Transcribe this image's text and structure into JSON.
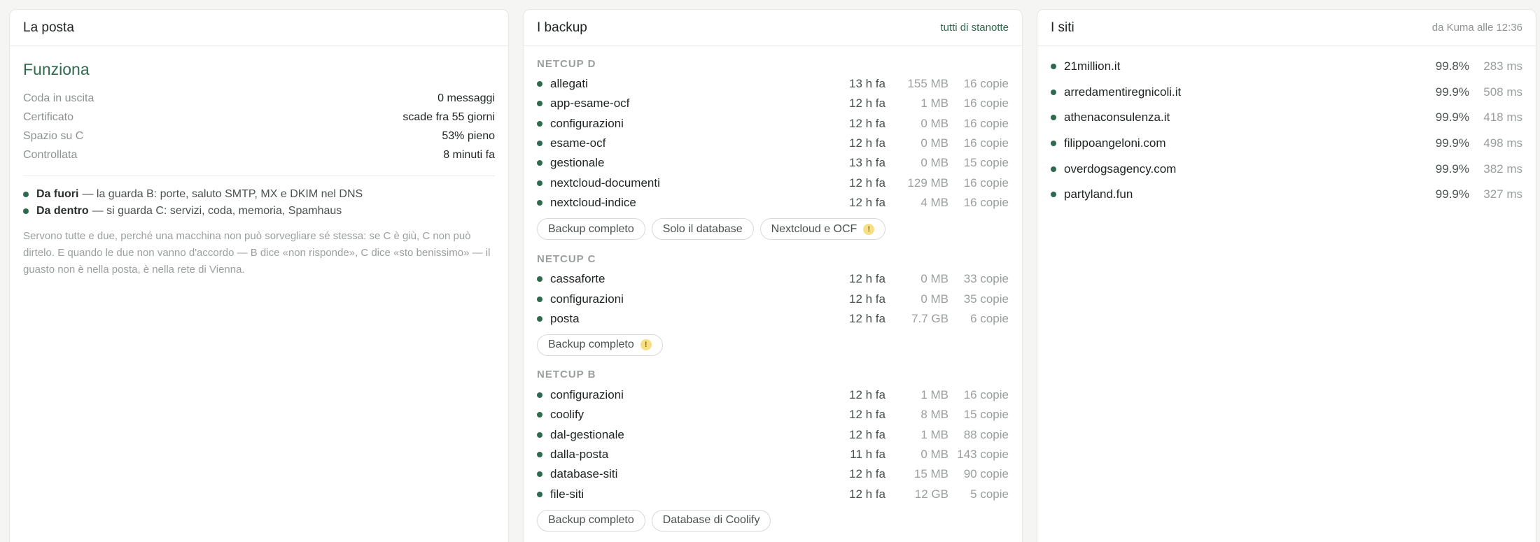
{
  "posta": {
    "title": "La posta",
    "status": "Funziona",
    "rows": [
      {
        "label": "Coda in uscita",
        "value": "0 messaggi"
      },
      {
        "label": "Certificato",
        "value": "scade fra 55 giorni"
      },
      {
        "label": "Spazio su C",
        "value": "53% pieno"
      },
      {
        "label": "Controllata",
        "value": "8 minuti fa"
      }
    ],
    "checks": [
      {
        "strong": "Da fuori",
        "text": "— la guarda B: porte, saluto SMTP, MX e DKIM nel DNS"
      },
      {
        "strong": "Da dentro",
        "text": "— si guarda C: servizi, coda, memoria, Spamhaus"
      }
    ],
    "note": "Servono tutte e due, perché una macchina non può sorvegliare sé stessa: se C è giù, C non può dirtelo. E quando le due non vanno d'accordo — B dice «non risponde», C dice «sto benissimo» — il guasto non è nella posta, è nella rete di Vienna."
  },
  "backup": {
    "title": "I backup",
    "meta": "tutti di stanotte",
    "groups": [
      {
        "label": "NETCUP D",
        "items": [
          {
            "name": "allegati",
            "ago": "13 h fa",
            "size": "155 MB",
            "copies": "16 copie"
          },
          {
            "name": "app-esame-ocf",
            "ago": "12 h fa",
            "size": "1 MB",
            "copies": "16 copie"
          },
          {
            "name": "configurazioni",
            "ago": "12 h fa",
            "size": "0 MB",
            "copies": "16 copie"
          },
          {
            "name": "esame-ocf",
            "ago": "12 h fa",
            "size": "0 MB",
            "copies": "16 copie"
          },
          {
            "name": "gestionale",
            "ago": "13 h fa",
            "size": "0 MB",
            "copies": "15 copie"
          },
          {
            "name": "nextcloud-documenti",
            "ago": "12 h fa",
            "size": "129 MB",
            "copies": "16 copie"
          },
          {
            "name": "nextcloud-indice",
            "ago": "12 h fa",
            "size": "4 MB",
            "copies": "16 copie"
          }
        ],
        "buttons": [
          {
            "label": "Backup completo",
            "warn": false
          },
          {
            "label": "Solo il database",
            "warn": false
          },
          {
            "label": "Nextcloud e OCF",
            "warn": true
          }
        ]
      },
      {
        "label": "NETCUP C",
        "items": [
          {
            "name": "cassaforte",
            "ago": "12 h fa",
            "size": "0 MB",
            "copies": "33 copie"
          },
          {
            "name": "configurazioni",
            "ago": "12 h fa",
            "size": "0 MB",
            "copies": "35 copie"
          },
          {
            "name": "posta",
            "ago": "12 h fa",
            "size": "7.7 GB",
            "copies": "6 copie"
          }
        ],
        "buttons": [
          {
            "label": "Backup completo",
            "warn": true
          }
        ]
      },
      {
        "label": "NETCUP B",
        "items": [
          {
            "name": "configurazioni",
            "ago": "12 h fa",
            "size": "1 MB",
            "copies": "16 copie"
          },
          {
            "name": "coolify",
            "ago": "12 h fa",
            "size": "8 MB",
            "copies": "15 copie"
          },
          {
            "name": "dal-gestionale",
            "ago": "12 h fa",
            "size": "1 MB",
            "copies": "88 copie"
          },
          {
            "name": "dalla-posta",
            "ago": "11 h fa",
            "size": "0 MB",
            "copies": "143 copie"
          },
          {
            "name": "database-siti",
            "ago": "12 h fa",
            "size": "15 MB",
            "copies": "90 copie"
          },
          {
            "name": "file-siti",
            "ago": "12 h fa",
            "size": "12 GB",
            "copies": "5 copie"
          }
        ],
        "buttons": [
          {
            "label": "Backup completo",
            "warn": false
          },
          {
            "label": "Database di Coolify",
            "warn": false
          }
        ]
      }
    ],
    "warn_glyph": "!"
  },
  "siti": {
    "title": "I siti",
    "meta": "da Kuma alle 12:36",
    "items": [
      {
        "name": "21million.it",
        "uptime": "99.8%",
        "latency": "283 ms"
      },
      {
        "name": "arredamentiregnicoli.it",
        "uptime": "99.9%",
        "latency": "508 ms"
      },
      {
        "name": "athenaconsulenza.it",
        "uptime": "99.9%",
        "latency": "418 ms"
      },
      {
        "name": "filippoangeloni.com",
        "uptime": "99.9%",
        "latency": "498 ms"
      },
      {
        "name": "overdogsagency.com",
        "uptime": "99.9%",
        "latency": "382 ms"
      },
      {
        "name": "partyland.fun",
        "uptime": "99.9%",
        "latency": "327 ms"
      }
    ]
  },
  "colors": {
    "accent": "#2e6a4e",
    "muted": "#9a9f9c",
    "warn": "#f6df86"
  }
}
